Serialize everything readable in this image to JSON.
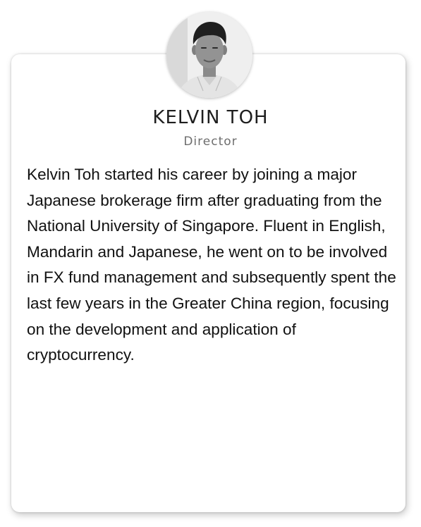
{
  "profile": {
    "name": "KELVIN TOH",
    "role": "Director",
    "bio": "Kelvin Toh started his career by joining a major Japanese brokerage firm after graduating from the National University of Singapore. Fluent in English, Mandarin and Japanese, he went on to be involved in FX fund management and subsequently spent the last few years in the Greater China region, focusing on the development and application of cryptocurrency.",
    "photo_icon": "profile-photo"
  }
}
